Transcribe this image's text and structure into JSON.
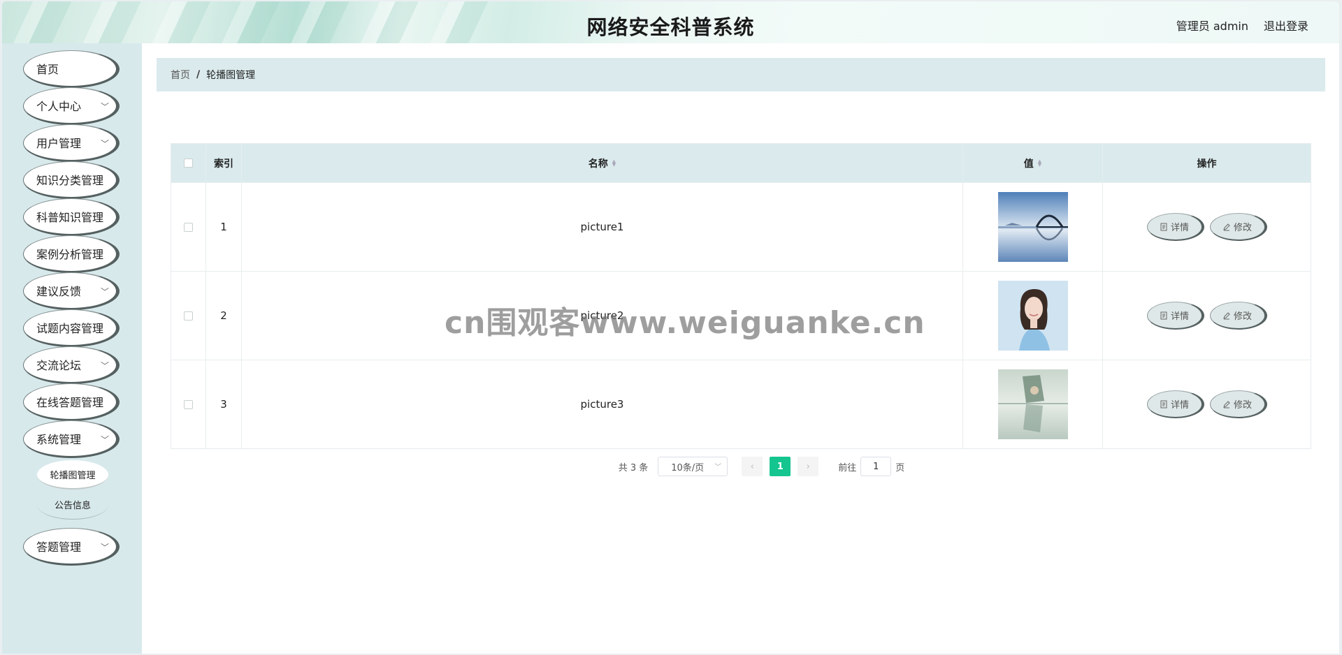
{
  "header": {
    "title": "网络安全科普系统",
    "user": "管理员 admin",
    "logout": "退出登录"
  },
  "sidebar": {
    "items": [
      {
        "label": "首页",
        "has_children": false
      },
      {
        "label": "个人中心",
        "has_children": true
      },
      {
        "label": "用户管理",
        "has_children": true
      },
      {
        "label": "知识分类管理",
        "has_children": true
      },
      {
        "label": "科普知识管理",
        "has_children": true
      },
      {
        "label": "案例分析管理",
        "has_children": true
      },
      {
        "label": "建议反馈",
        "has_children": true
      },
      {
        "label": "试题内容管理",
        "has_children": true
      },
      {
        "label": "交流论坛",
        "has_children": true
      },
      {
        "label": "在线答题管理",
        "has_children": true
      },
      {
        "label": "系统管理",
        "has_children": true
      },
      {
        "label": "答题管理",
        "has_children": true
      }
    ],
    "sub_items": [
      {
        "label": "轮播图管理",
        "active": true
      },
      {
        "label": "公告信息",
        "active": false
      }
    ]
  },
  "breadcrumb": {
    "home": "首页",
    "separator": "/",
    "current": "轮播图管理"
  },
  "table": {
    "columns": {
      "index": "索引",
      "name": "名称",
      "value": "值",
      "actions": "操作"
    },
    "rows": [
      {
        "index": "1",
        "name": "picture1",
        "image": "bridge-lake-photo"
      },
      {
        "index": "2",
        "name": "picture2",
        "image": "woman-portrait-photo"
      },
      {
        "index": "3",
        "name": "picture3",
        "image": "reflection-photo"
      }
    ],
    "detail_label": "详情",
    "edit_label": "修改"
  },
  "pagination": {
    "total": "共 3 条",
    "page_size": "10条/页",
    "current_page": "1",
    "goto_prefix": "前往",
    "goto_value": "1",
    "goto_suffix": "页",
    "prev_icon": "‹",
    "next_icon": "›"
  },
  "watermark": "cn围观客www.weiguanke.cn",
  "colors": {
    "accent": "#14c58f",
    "table_header": "#dbeaed",
    "sidebar": "#d8e9ec"
  }
}
